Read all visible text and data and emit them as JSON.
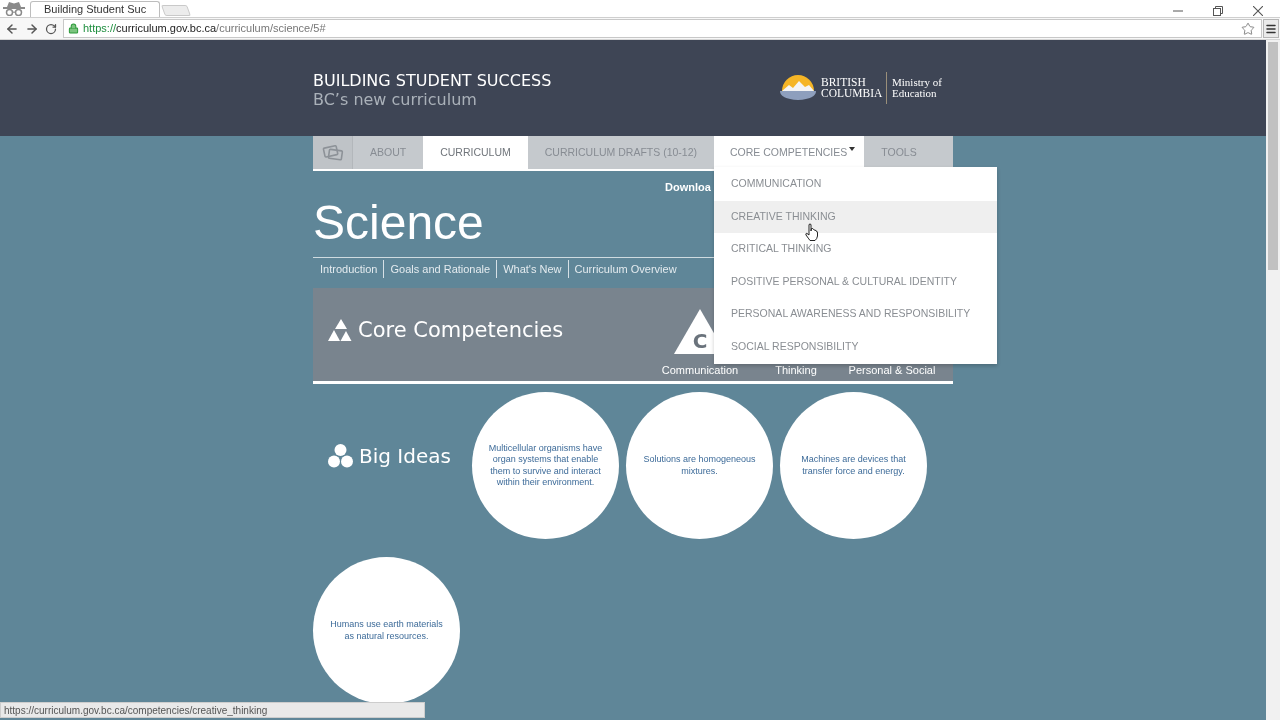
{
  "browser": {
    "tab": {
      "title": "Building Student Suc"
    },
    "address": {
      "scheme": "https://",
      "host": "curriculum.gov.bc.ca",
      "path": "/curriculum/science/5#"
    }
  },
  "header": {
    "title": "BUILDING STUDENT SUCCESS",
    "subtitle": "BC’s new curriculum",
    "logo": {
      "province": "BRITISH COLUMBIA",
      "ministry": "Ministry of Education"
    }
  },
  "nav": [
    {
      "kind": "icon",
      "selected": false
    },
    {
      "kind": "link",
      "label": "ABOUT",
      "selected": false
    },
    {
      "kind": "link",
      "label": "CURRICULUM",
      "selected": true
    },
    {
      "kind": "link",
      "label": "CURRICULUM DRAFTS (10-12)",
      "selected": false
    },
    {
      "kind": "dropdown",
      "label": "CORE COMPETENCIES",
      "selected": false,
      "expanded": true,
      "menu": [
        {
          "label": "COMMUNICATION",
          "highlighted": false
        },
        {
          "label": "CREATIVE THINKING",
          "highlighted": true
        },
        {
          "label": "CRITICAL THINKING",
          "highlighted": false
        },
        {
          "label": "POSITIVE PERSONAL & CULTURAL IDENTITY",
          "highlighted": false
        },
        {
          "label": "PERSONAL AWARENESS AND RESPONSIBILITY",
          "highlighted": false
        },
        {
          "label": "SOCIAL RESPONSIBILITY",
          "highlighted": false
        }
      ]
    },
    {
      "kind": "link",
      "label": "TOOLS",
      "selected": false
    }
  ],
  "download": {
    "label": "Downloa"
  },
  "page_title": "Science",
  "subnav": [
    {
      "label": "Introduction"
    },
    {
      "label": "Goals and Rationale"
    },
    {
      "label": "What's New"
    },
    {
      "label": "Curriculum Overview"
    }
  ],
  "core_competencies": {
    "title": "Core Competencies",
    "badge_letter": "C",
    "labels": [
      "Communication",
      "Thinking",
      "Personal & Social"
    ]
  },
  "big_ideas": {
    "title": "Big Ideas",
    "ideas": [
      "Multicellular organisms have organ systems that enable them to survive and interact within their environment.",
      "Solutions are homogeneous mixtures.",
      "Machines are devices that transfer force and energy.",
      "Humans use earth materials as natural resources."
    ]
  },
  "status_bar": {
    "url": "https://curriculum.gov.bc.ca/competencies/creative_thinking"
  }
}
